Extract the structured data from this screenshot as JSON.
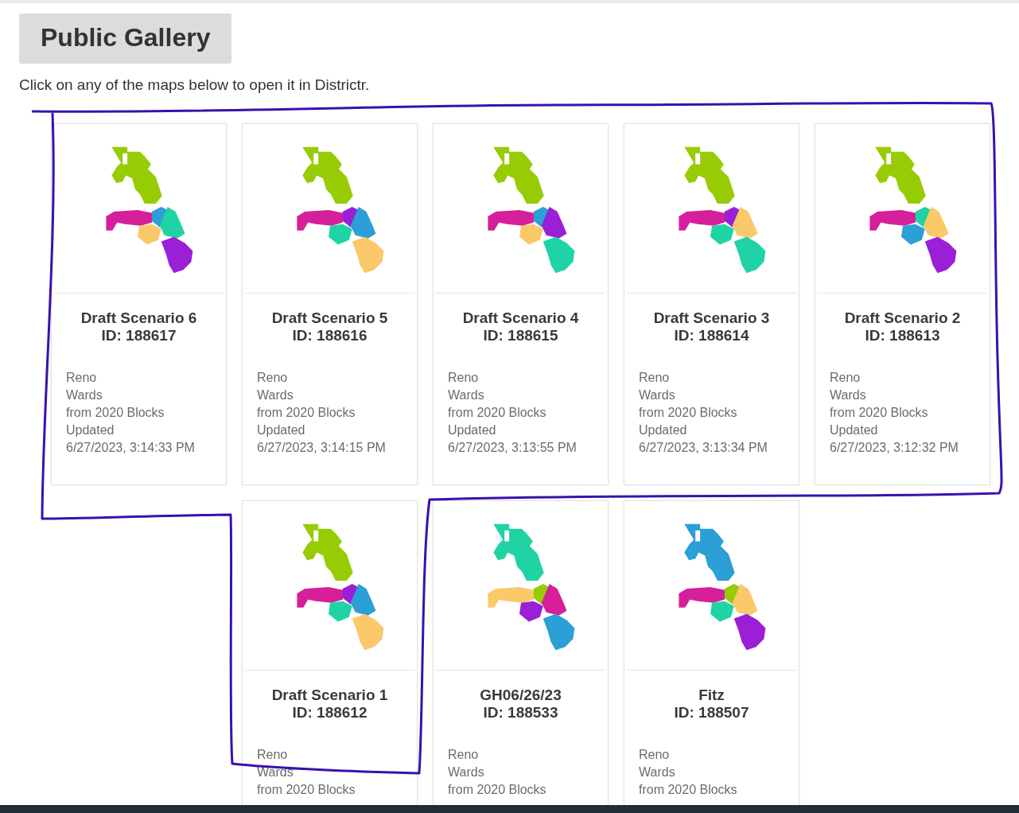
{
  "header": {
    "title": "Public Gallery",
    "intro": "Click on any of the maps below to open it in Districtr."
  },
  "maps": [
    {
      "name": "Draft Scenario 6",
      "id": "ID: 188617",
      "details": [
        "Reno",
        "Wards",
        "from 2020 Blocks",
        "Updated",
        "6/27/2023, 3:14:33 PM"
      ]
    },
    {
      "name": "Draft Scenario 5",
      "id": "ID: 188616",
      "details": [
        "Reno",
        "Wards",
        "from 2020 Blocks",
        "Updated",
        "6/27/2023, 3:14:15 PM"
      ]
    },
    {
      "name": "Draft Scenario 4",
      "id": "ID: 188615",
      "details": [
        "Reno",
        "Wards",
        "from 2020 Blocks",
        "Updated",
        "6/27/2023, 3:13:55 PM"
      ]
    },
    {
      "name": "Draft Scenario 3",
      "id": "ID: 188614",
      "details": [
        "Reno",
        "Wards",
        "from 2020 Blocks",
        "Updated",
        "6/27/2023, 3:13:34 PM"
      ]
    },
    {
      "name": "Draft Scenario 2",
      "id": "ID: 188613",
      "details": [
        "Reno",
        "Wards",
        "from 2020 Blocks",
        "Updated",
        "6/27/2023, 3:12:32 PM"
      ]
    },
    {
      "name": "Draft Scenario 1",
      "id": "ID: 188612",
      "details": [
        "Reno",
        "Wards",
        "from 2020 Blocks"
      ]
    },
    {
      "name": "GH06/26/23",
      "id": "ID: 188533",
      "details": [
        "Reno",
        "Wards",
        "from 2020 Blocks"
      ]
    },
    {
      "name": "Fitz",
      "id": "ID: 188507",
      "details": [
        "Reno",
        "Wards",
        "from 2020 Blocks"
      ]
    }
  ]
}
